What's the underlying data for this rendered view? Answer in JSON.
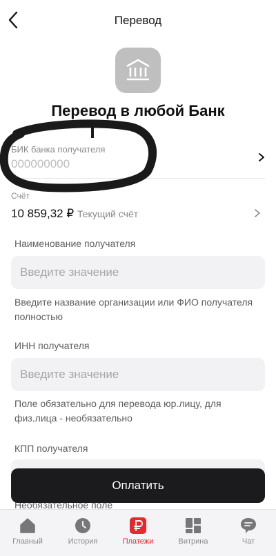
{
  "header": {
    "title": "Перевод",
    "back_icon": "chevron-left-icon"
  },
  "page": {
    "icon": "bank-building-icon",
    "title": "Перевод в любой Банк"
  },
  "bik": {
    "label": "БИК банка получателя",
    "placeholder": "000000000"
  },
  "account": {
    "label": "Счёт",
    "amount": "10 859,32 ₽",
    "name": "Текущий счёт"
  },
  "recipient_name": {
    "label": "Наименование получателя",
    "placeholder": "Введите значение",
    "hint": "Введите название организации или ФИО получателя полностью"
  },
  "inn": {
    "label": "ИНН получателя",
    "placeholder": "Введите значение",
    "hint": "Поле обязательно для перевода юр.лицу, для физ.лица - необязательно"
  },
  "kpp": {
    "label": "КПП получателя",
    "hint": "Необязательное поле"
  },
  "pay_button": "Оплатить",
  "colors": {
    "accent": "#e8282b",
    "button": "#1b1b1d",
    "field_bg": "#f2f2f4"
  },
  "tabbar": {
    "active": "Платежи",
    "tabs": [
      {
        "label": "Главный",
        "icon": "home-icon"
      },
      {
        "label": "История",
        "icon": "clock-icon"
      },
      {
        "label": "Платежи",
        "icon": "ruble-icon"
      },
      {
        "label": "Витрина",
        "icon": "grid-icon"
      },
      {
        "label": "Чат",
        "icon": "chat-icon"
      }
    ]
  }
}
